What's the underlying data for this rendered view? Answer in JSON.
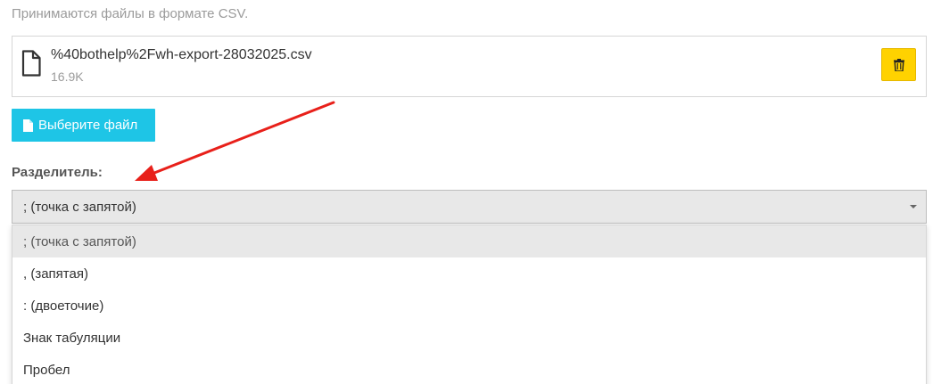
{
  "upload": {
    "hint": "Принимаются файлы в формате CSV.",
    "file_name": "%40bothelp%2Fwh-export-28032025.csv",
    "file_size": "16.9K",
    "choose_label": "Выберите файл"
  },
  "separator": {
    "label": "Разделитель:",
    "selected": "; (точка с запятой)",
    "options": [
      "; (точка с запятой)",
      ", (запятая)",
      ": (двоеточие)",
      "Знак табуляции",
      "Пробел"
    ]
  },
  "colors": {
    "delete_button": "#ffd200",
    "choose_button": "#1ec5e6",
    "annotation_arrow": "#e8201a"
  },
  "icons": {
    "file": "file-icon",
    "delete": "trash-icon",
    "choose": "document-icon",
    "select": "caret-down-icon"
  }
}
